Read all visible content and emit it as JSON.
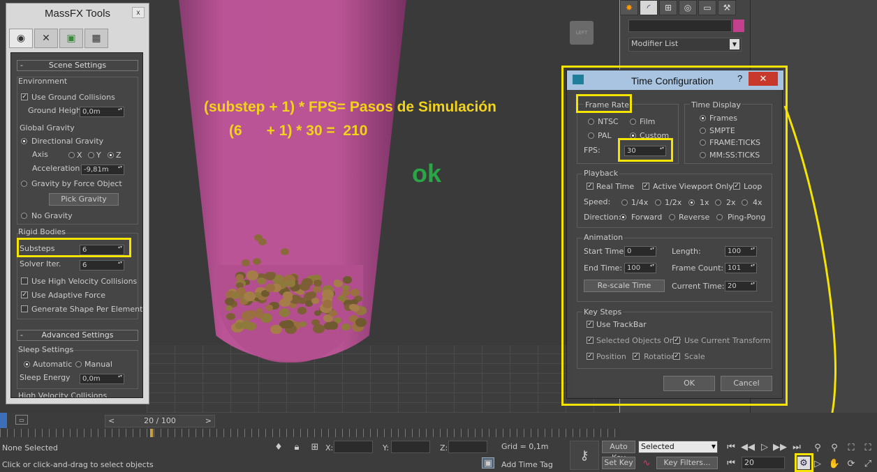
{
  "viewport": {
    "annotation_line1": "(substep + 1) * FPS= Pasos de Simulación",
    "annotation_line2": "(6      + 1) * 30 =  210",
    "ok_text": "ok",
    "viewcube_label": "LEFT"
  },
  "massfx": {
    "title": "MassFX Tools",
    "close": "x",
    "scene_settings": {
      "header": "Scene Settings",
      "collapse": "-",
      "environment_label": "Environment",
      "use_ground_collisions": {
        "label": "Use Ground Collisions",
        "checked": true
      },
      "ground_height_label": "Ground Height",
      "ground_height": "0,0m",
      "global_gravity_label": "Global Gravity",
      "directional_gravity": "Directional Gravity",
      "axis_label": "Axis",
      "axis_x": "X",
      "axis_y": "Y",
      "axis_z": "Z",
      "acceleration_label": "Acceleration",
      "acceleration": "-9,81m",
      "gravity_by_force": "Gravity by Force Object",
      "pick_gravity": "Pick Gravity",
      "no_gravity": "No Gravity",
      "rigid_bodies_label": "Rigid Bodies",
      "substeps_label": "Substeps",
      "substeps": "6",
      "solver_iter_label": "Solver Iter.",
      "solver_iter": "6",
      "use_high_velocity": "Use High Velocity Collisions",
      "use_adaptive_force": "Use Adaptive Force",
      "generate_shape": "Generate Shape Per Element"
    },
    "advanced_settings": {
      "header": "Advanced Settings",
      "collapse": "-",
      "sleep_settings_label": "Sleep Settings",
      "automatic": "Automatic",
      "manual": "Manual",
      "sleep_energy_label": "Sleep Energy",
      "sleep_energy": "0,0m",
      "high_velocity_label": "High Velocity Collisions"
    }
  },
  "right_panel": {
    "modifier_list": "Modifier List",
    "color_swatch": "#c2408c"
  },
  "time_config": {
    "title": "Time Configuration",
    "help": "?",
    "close": "✕",
    "frame_rate": {
      "label": "Frame Rate",
      "ntsc": "NTSC",
      "film": "Film",
      "pal": "PAL",
      "custom": "Custom",
      "fps_label": "FPS:",
      "fps": "30"
    },
    "time_display": {
      "label": "Time Display",
      "frames": "Frames",
      "smpte": "SMPTE",
      "frame_ticks": "FRAME:TICKS",
      "mmss_ticks": "MM:SS:TICKS"
    },
    "playback": {
      "label": "Playback",
      "real_time": "Real Time",
      "active_viewport_only": "Active Viewport Only",
      "loop": "Loop",
      "speed_label": "Speed:",
      "speeds": [
        "1/4x",
        "1/2x",
        "1x",
        "2x",
        "4x"
      ],
      "direction_label": "Direction:",
      "forward": "Forward",
      "reverse": "Reverse",
      "ping_pong": "Ping-Pong"
    },
    "animation": {
      "label": "Animation",
      "start_time_label": "Start Time:",
      "start_time": "0",
      "length_label": "Length:",
      "length": "100",
      "end_time_label": "End Time:",
      "end_time": "100",
      "frame_count_label": "Frame Count:",
      "frame_count": "101",
      "rescale_time": "Re-scale Time",
      "current_time_label": "Current Time:",
      "current_time": "20"
    },
    "key_steps": {
      "label": "Key Steps",
      "use_trackbar": "Use TrackBar",
      "selected_objects_only": "Selected Objects Only",
      "use_current_transform": "Use Current Transform",
      "position": "Position",
      "rotation": "Rotation",
      "scale": "Scale"
    },
    "ok": "OK",
    "cancel": "Cancel"
  },
  "bottom": {
    "time_slider": "20 / 100",
    "prev": "<",
    "next": ">",
    "none_selected": "None Selected",
    "status": "Click or click-and-drag to select objects",
    "x_label": "X:",
    "y_label": "Y:",
    "z_label": "Z:",
    "grid": "Grid = 0,1m",
    "add_time_tag": "Add Time Tag",
    "auto_key": "Auto Key",
    "set_key": "Set Key",
    "selected": "Selected",
    "key_filters": "Key Filters...",
    "current_frame": "20"
  }
}
